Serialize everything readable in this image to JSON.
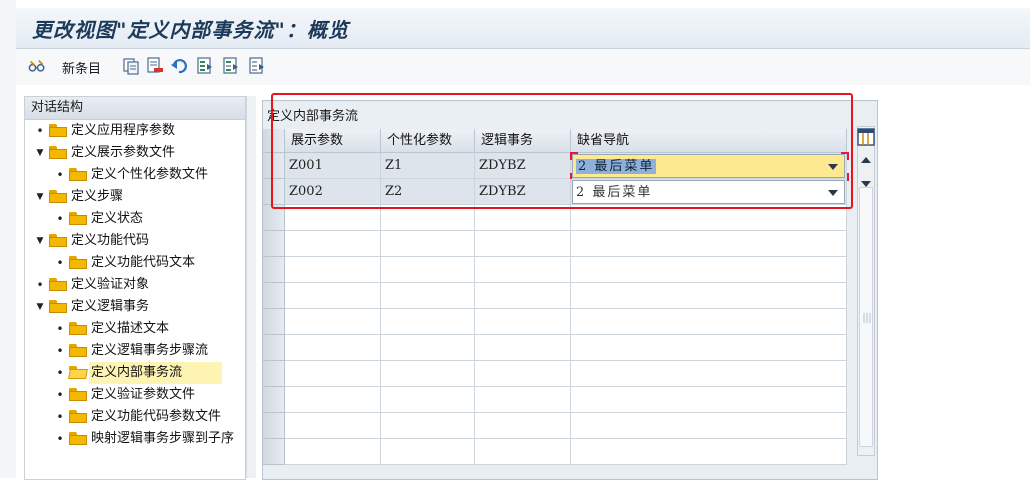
{
  "window": {
    "title": "更改视图\"定义内部事务流\"：概览"
  },
  "toolbar": {
    "new_entries_label": "新条目"
  },
  "tree": {
    "header": "对话结构",
    "items": [
      {
        "label": "定义应用程序参数",
        "level": 0,
        "type": "leaf"
      },
      {
        "label": "定义展示参数文件",
        "level": 0,
        "type": "expanded"
      },
      {
        "label": "定义个性化参数文件",
        "level": 1,
        "type": "leaf"
      },
      {
        "label": "定义步骤",
        "level": 0,
        "type": "expanded"
      },
      {
        "label": "定义状态",
        "level": 1,
        "type": "leaf"
      },
      {
        "label": "定义功能代码",
        "level": 0,
        "type": "expanded"
      },
      {
        "label": "定义功能代码文本",
        "level": 1,
        "type": "leaf"
      },
      {
        "label": "定义验证对象",
        "level": 0,
        "type": "leaf"
      },
      {
        "label": "定义逻辑事务",
        "level": 0,
        "type": "expanded"
      },
      {
        "label": "定义描述文本",
        "level": 1,
        "type": "leaf"
      },
      {
        "label": "定义逻辑事务步骤流",
        "level": 1,
        "type": "leaf"
      },
      {
        "label": "定义内部事务流",
        "level": 1,
        "type": "leaf",
        "selected": true
      },
      {
        "label": "定义验证参数文件",
        "level": 1,
        "type": "leaf"
      },
      {
        "label": "定义功能代码参数文件",
        "level": 1,
        "type": "leaf"
      },
      {
        "label": "映射逻辑事务步骤到子序",
        "level": 1,
        "type": "leaf"
      }
    ]
  },
  "table": {
    "title": "定义内部事务流",
    "columns": [
      "展示参数",
      "个性化参数",
      "逻辑事务",
      "缺省导航"
    ],
    "rows": [
      {
        "c0": "Z001",
        "c1": "Z1",
        "c2": "ZDYBZ",
        "c3": "2 最后菜单",
        "focused": true
      },
      {
        "c0": "Z002",
        "c1": "Z2",
        "c2": "ZDYBZ",
        "c3": "2 最后菜单",
        "focused": false
      }
    ]
  },
  "colors": {
    "highlight": "#e8141c",
    "focus_field": "#fde98f",
    "selection_text": "#8fb0d8",
    "folder": "#f5b800"
  }
}
